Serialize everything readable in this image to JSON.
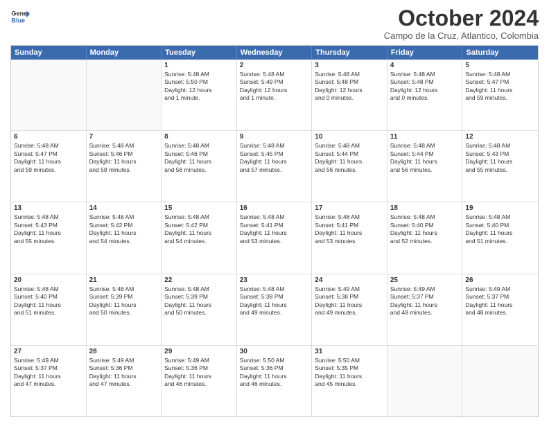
{
  "header": {
    "logo_line1": "General",
    "logo_line2": "Blue",
    "month": "October 2024",
    "location": "Campo de la Cruz, Atlantico, Colombia"
  },
  "day_headers": [
    "Sunday",
    "Monday",
    "Tuesday",
    "Wednesday",
    "Thursday",
    "Friday",
    "Saturday"
  ],
  "weeks": [
    [
      {
        "day": "",
        "info": ""
      },
      {
        "day": "",
        "info": ""
      },
      {
        "day": "1",
        "info": "Sunrise: 5:48 AM\nSunset: 5:50 PM\nDaylight: 12 hours\nand 1 minute."
      },
      {
        "day": "2",
        "info": "Sunrise: 5:48 AM\nSunset: 5:49 PM\nDaylight: 12 hours\nand 1 minute."
      },
      {
        "day": "3",
        "info": "Sunrise: 5:48 AM\nSunset: 5:48 PM\nDaylight: 12 hours\nand 0 minutes."
      },
      {
        "day": "4",
        "info": "Sunrise: 5:48 AM\nSunset: 5:48 PM\nDaylight: 12 hours\nand 0 minutes."
      },
      {
        "day": "5",
        "info": "Sunrise: 5:48 AM\nSunset: 5:47 PM\nDaylight: 11 hours\nand 59 minutes."
      }
    ],
    [
      {
        "day": "6",
        "info": "Sunrise: 5:48 AM\nSunset: 5:47 PM\nDaylight: 11 hours\nand 59 minutes."
      },
      {
        "day": "7",
        "info": "Sunrise: 5:48 AM\nSunset: 5:46 PM\nDaylight: 11 hours\nand 58 minutes."
      },
      {
        "day": "8",
        "info": "Sunrise: 5:48 AM\nSunset: 5:46 PM\nDaylight: 11 hours\nand 58 minutes."
      },
      {
        "day": "9",
        "info": "Sunrise: 5:48 AM\nSunset: 5:45 PM\nDaylight: 11 hours\nand 57 minutes."
      },
      {
        "day": "10",
        "info": "Sunrise: 5:48 AM\nSunset: 5:44 PM\nDaylight: 11 hours\nand 56 minutes."
      },
      {
        "day": "11",
        "info": "Sunrise: 5:48 AM\nSunset: 5:44 PM\nDaylight: 11 hours\nand 56 minutes."
      },
      {
        "day": "12",
        "info": "Sunrise: 5:48 AM\nSunset: 5:43 PM\nDaylight: 11 hours\nand 55 minutes."
      }
    ],
    [
      {
        "day": "13",
        "info": "Sunrise: 5:48 AM\nSunset: 5:43 PM\nDaylight: 11 hours\nand 55 minutes."
      },
      {
        "day": "14",
        "info": "Sunrise: 5:48 AM\nSunset: 5:42 PM\nDaylight: 11 hours\nand 54 minutes."
      },
      {
        "day": "15",
        "info": "Sunrise: 5:48 AM\nSunset: 5:42 PM\nDaylight: 11 hours\nand 54 minutes."
      },
      {
        "day": "16",
        "info": "Sunrise: 5:48 AM\nSunset: 5:41 PM\nDaylight: 11 hours\nand 53 minutes."
      },
      {
        "day": "17",
        "info": "Sunrise: 5:48 AM\nSunset: 5:41 PM\nDaylight: 11 hours\nand 53 minutes."
      },
      {
        "day": "18",
        "info": "Sunrise: 5:48 AM\nSunset: 5:40 PM\nDaylight: 11 hours\nand 52 minutes."
      },
      {
        "day": "19",
        "info": "Sunrise: 5:48 AM\nSunset: 5:40 PM\nDaylight: 11 hours\nand 51 minutes."
      }
    ],
    [
      {
        "day": "20",
        "info": "Sunrise: 5:48 AM\nSunset: 5:40 PM\nDaylight: 11 hours\nand 51 minutes."
      },
      {
        "day": "21",
        "info": "Sunrise: 5:48 AM\nSunset: 5:39 PM\nDaylight: 11 hours\nand 50 minutes."
      },
      {
        "day": "22",
        "info": "Sunrise: 5:48 AM\nSunset: 5:39 PM\nDaylight: 11 hours\nand 50 minutes."
      },
      {
        "day": "23",
        "info": "Sunrise: 5:48 AM\nSunset: 5:38 PM\nDaylight: 11 hours\nand 49 minutes."
      },
      {
        "day": "24",
        "info": "Sunrise: 5:49 AM\nSunset: 5:38 PM\nDaylight: 11 hours\nand 49 minutes."
      },
      {
        "day": "25",
        "info": "Sunrise: 5:49 AM\nSunset: 5:37 PM\nDaylight: 11 hours\nand 48 minutes."
      },
      {
        "day": "26",
        "info": "Sunrise: 5:49 AM\nSunset: 5:37 PM\nDaylight: 11 hours\nand 48 minutes."
      }
    ],
    [
      {
        "day": "27",
        "info": "Sunrise: 5:49 AM\nSunset: 5:37 PM\nDaylight: 11 hours\nand 47 minutes."
      },
      {
        "day": "28",
        "info": "Sunrise: 5:49 AM\nSunset: 5:36 PM\nDaylight: 11 hours\nand 47 minutes."
      },
      {
        "day": "29",
        "info": "Sunrise: 5:49 AM\nSunset: 5:36 PM\nDaylight: 11 hours\nand 46 minutes."
      },
      {
        "day": "30",
        "info": "Sunrise: 5:50 AM\nSunset: 5:36 PM\nDaylight: 11 hours\nand 46 minutes."
      },
      {
        "day": "31",
        "info": "Sunrise: 5:50 AM\nSunset: 5:35 PM\nDaylight: 11 hours\nand 45 minutes."
      },
      {
        "day": "",
        "info": ""
      },
      {
        "day": "",
        "info": ""
      }
    ]
  ]
}
